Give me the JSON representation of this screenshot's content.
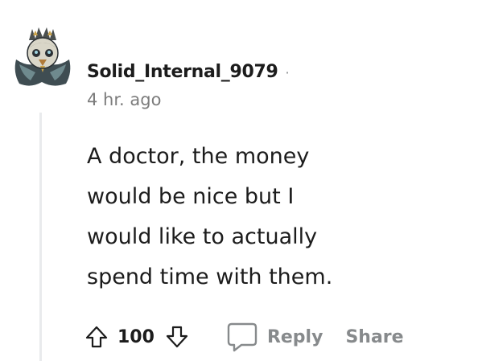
{
  "comment": {
    "author": "Solid_Internal_9079",
    "separator": "·",
    "timestamp": "4 hr. ago",
    "body_lines": [
      "A doctor, the money",
      "would be nice but I",
      "would like to actually",
      "spend time with them."
    ],
    "score": "100",
    "actions": {
      "reply_label": "Reply",
      "share_label": "Share"
    }
  },
  "colors": {
    "text": "#1c1c1c",
    "muted": "#878a8c",
    "thread_line": "#e9ebed"
  },
  "icons": {
    "avatar": "avatar-image",
    "upvote": "arrow-up-icon",
    "downvote": "arrow-down-icon",
    "reply": "speech-bubble-icon"
  }
}
